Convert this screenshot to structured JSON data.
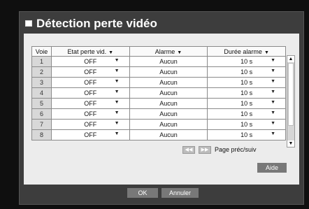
{
  "dialog": {
    "title": "Détection perte vidéo"
  },
  "table": {
    "headers": {
      "voie": "Voie",
      "etat": "Etat perte vid.",
      "alarme": "Alarme",
      "duree": "Durée alarme"
    },
    "rows": [
      {
        "voie": "1",
        "etat": "OFF",
        "alarme": "Aucun",
        "duree": "10 s"
      },
      {
        "voie": "2",
        "etat": "OFF",
        "alarme": "Aucun",
        "duree": "10 s"
      },
      {
        "voie": "3",
        "etat": "OFF",
        "alarme": "Aucun",
        "duree": "10 s"
      },
      {
        "voie": "4",
        "etat": "OFF",
        "alarme": "Aucun",
        "duree": "10 s"
      },
      {
        "voie": "5",
        "etat": "OFF",
        "alarme": "Aucun",
        "duree": "10 s"
      },
      {
        "voie": "6",
        "etat": "OFF",
        "alarme": "Aucun",
        "duree": "10 s"
      },
      {
        "voie": "7",
        "etat": "OFF",
        "alarme": "Aucun",
        "duree": "10 s"
      },
      {
        "voie": "8",
        "etat": "OFF",
        "alarme": "Aucun",
        "duree": "10 s"
      }
    ]
  },
  "pager": {
    "label": "Page préc/suiv",
    "prev_icon": "double-left-arrow",
    "next_icon": "double-right-arrow"
  },
  "buttons": {
    "aide": "Aide",
    "ok": "OK",
    "annuler": "Annuler"
  }
}
